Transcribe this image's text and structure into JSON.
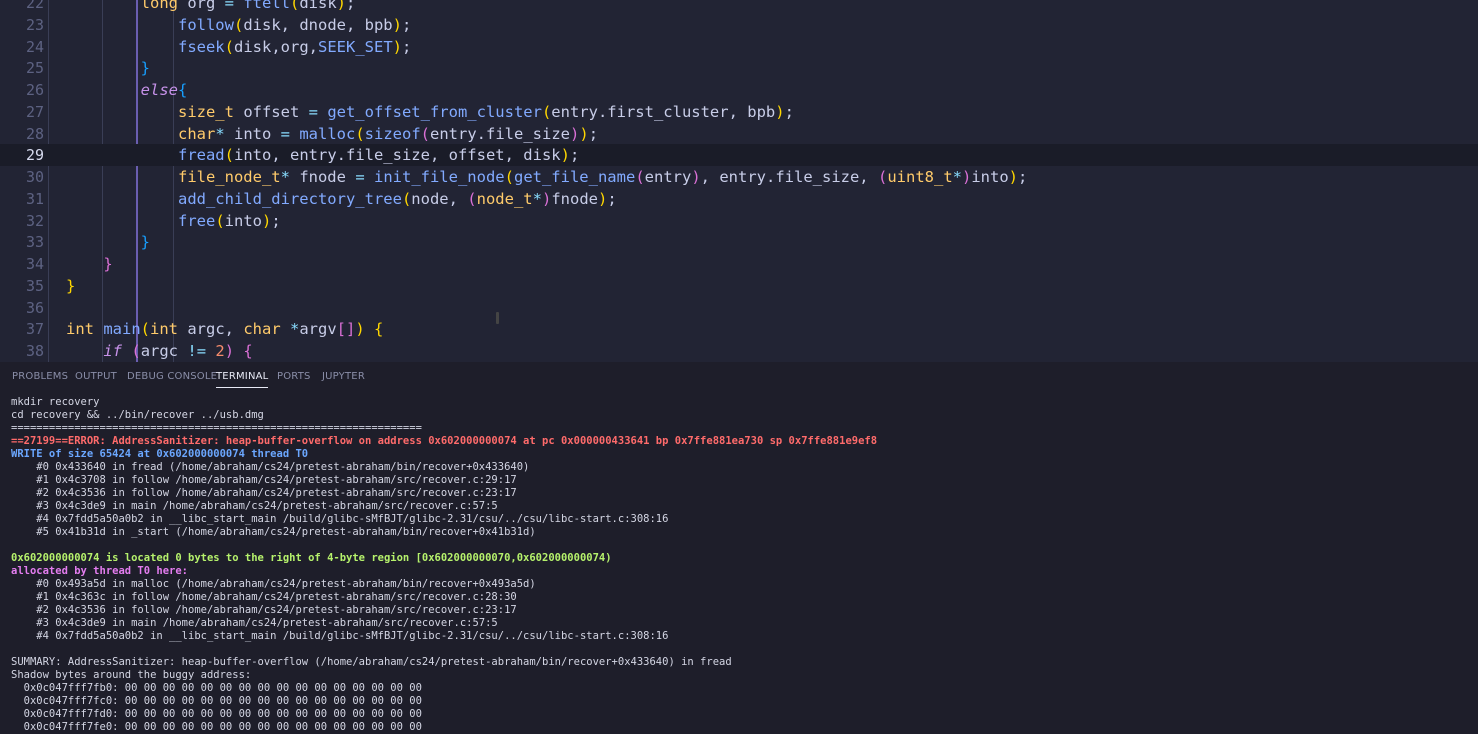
{
  "editor": {
    "lines": [
      {
        "n": "22",
        "tokens": [
          [
            "sp",
            "        "
          ],
          [
            "ty",
            "long"
          ],
          [
            "var",
            " org "
          ],
          [
            "op",
            "="
          ],
          [
            "fn",
            " ftell"
          ],
          [
            "br1",
            "("
          ],
          [
            "var",
            "disk"
          ],
          [
            "br1",
            ")"
          ],
          [
            "var",
            ";"
          ]
        ]
      },
      {
        "n": "23",
        "tokens": [
          [
            "sp",
            "            "
          ],
          [
            "fn",
            "follow"
          ],
          [
            "br1",
            "("
          ],
          [
            "var",
            "disk, dnode, bpb"
          ],
          [
            "br1",
            ")"
          ],
          [
            "var",
            ";"
          ]
        ]
      },
      {
        "n": "24",
        "tokens": [
          [
            "sp",
            "            "
          ],
          [
            "fn",
            "fseek"
          ],
          [
            "br1",
            "("
          ],
          [
            "var",
            "disk,org,"
          ],
          [
            "cst",
            "SEEK_SET"
          ],
          [
            "br1",
            ")"
          ],
          [
            "var",
            ";"
          ]
        ]
      },
      {
        "n": "25",
        "tokens": [
          [
            "sp",
            "        "
          ],
          [
            "br3",
            "}"
          ]
        ]
      },
      {
        "n": "26",
        "tokens": [
          [
            "sp",
            "        "
          ],
          [
            "kw",
            "else"
          ],
          [
            "br3",
            "{"
          ]
        ]
      },
      {
        "n": "27",
        "tokens": [
          [
            "sp",
            "            "
          ],
          [
            "ty",
            "size_t"
          ],
          [
            "var",
            " offset "
          ],
          [
            "op",
            "="
          ],
          [
            "fn",
            " get_offset_from_cluster"
          ],
          [
            "br1",
            "("
          ],
          [
            "var",
            "entry.first_cluster, bpb"
          ],
          [
            "br1",
            ")"
          ],
          [
            "var",
            ";"
          ]
        ]
      },
      {
        "n": "28",
        "tokens": [
          [
            "sp",
            "            "
          ],
          [
            "ty",
            "char"
          ],
          [
            "op",
            "*"
          ],
          [
            "var",
            " into "
          ],
          [
            "op",
            "="
          ],
          [
            "fn",
            " malloc"
          ],
          [
            "br1",
            "("
          ],
          [
            "fn",
            "sizeof"
          ],
          [
            "br2",
            "("
          ],
          [
            "var",
            "entry.file_size"
          ],
          [
            "br2",
            ")"
          ],
          [
            "br1",
            ")"
          ],
          [
            "var",
            ";"
          ]
        ]
      },
      {
        "n": "29",
        "tokens": [
          [
            "sp",
            "            "
          ],
          [
            "fn",
            "fread"
          ],
          [
            "br1",
            "("
          ],
          [
            "var",
            "into, entry.file_size, offset, disk"
          ],
          [
            "br1",
            ")"
          ],
          [
            "var",
            ";"
          ]
        ]
      },
      {
        "n": "30",
        "tokens": [
          [
            "sp",
            "            "
          ],
          [
            "ty",
            "file_node_t"
          ],
          [
            "op",
            "*"
          ],
          [
            "var",
            " fnode "
          ],
          [
            "op",
            "="
          ],
          [
            "fn",
            " init_file_node"
          ],
          [
            "br1",
            "("
          ],
          [
            "fn",
            "get_file_name"
          ],
          [
            "br2",
            "("
          ],
          [
            "var",
            "entry"
          ],
          [
            "br2",
            ")"
          ],
          [
            "var",
            ", entry.file_size, "
          ],
          [
            "br2",
            "("
          ],
          [
            "ty",
            "uint8_t"
          ],
          [
            "op",
            "*"
          ],
          [
            "br2",
            ")"
          ],
          [
            "var",
            "into"
          ],
          [
            "br1",
            ")"
          ],
          [
            "var",
            ";"
          ]
        ]
      },
      {
        "n": "31",
        "tokens": [
          [
            "sp",
            "            "
          ],
          [
            "fn",
            "add_child_directory_tree"
          ],
          [
            "br1",
            "("
          ],
          [
            "var",
            "node, "
          ],
          [
            "br2",
            "("
          ],
          [
            "ty",
            "node_t"
          ],
          [
            "op",
            "*"
          ],
          [
            "br2",
            ")"
          ],
          [
            "var",
            "fnode"
          ],
          [
            "br1",
            ")"
          ],
          [
            "var",
            ";"
          ]
        ]
      },
      {
        "n": "32",
        "tokens": [
          [
            "sp",
            "            "
          ],
          [
            "fn",
            "free"
          ],
          [
            "br1",
            "("
          ],
          [
            "var",
            "into"
          ],
          [
            "br1",
            ")"
          ],
          [
            "var",
            ";"
          ]
        ]
      },
      {
        "n": "33",
        "tokens": [
          [
            "sp",
            "        "
          ],
          [
            "br3",
            "}"
          ]
        ]
      },
      {
        "n": "34",
        "tokens": [
          [
            "sp",
            "    "
          ],
          [
            "br2",
            "}"
          ]
        ]
      },
      {
        "n": "35",
        "tokens": [
          [
            "br1",
            "}"
          ]
        ]
      },
      {
        "n": "36",
        "tokens": []
      },
      {
        "n": "37",
        "tokens": [
          [
            "ty",
            "int"
          ],
          [
            "fn",
            " main"
          ],
          [
            "br1",
            "("
          ],
          [
            "ty",
            "int"
          ],
          [
            "var",
            " argc, "
          ],
          [
            "ty",
            "char"
          ],
          [
            "op",
            " *"
          ],
          [
            "var",
            "argv"
          ],
          [
            "br2",
            "[]"
          ],
          [
            "br1",
            ")"
          ],
          [
            "var",
            " "
          ],
          [
            "br1",
            "{"
          ]
        ]
      },
      {
        "n": "38",
        "tokens": [
          [
            "sp",
            "    "
          ],
          [
            "kw",
            "if"
          ],
          [
            "var",
            " "
          ],
          [
            "br2",
            "("
          ],
          [
            "var",
            "argc "
          ],
          [
            "op",
            "!="
          ],
          [
            "var",
            " "
          ],
          [
            "num",
            "2"
          ],
          [
            "br2",
            ")"
          ],
          [
            "var",
            " "
          ],
          [
            "br2",
            "{"
          ]
        ]
      }
    ],
    "current_line": "29"
  },
  "panel": {
    "tabs": [
      {
        "label": "PROBLEMS",
        "active": false
      },
      {
        "label": "OUTPUT",
        "active": false
      },
      {
        "label": "DEBUG CONSOLE",
        "active": false
      },
      {
        "label": "TERMINAL",
        "active": true
      },
      {
        "label": "PORTS",
        "active": false
      },
      {
        "label": "JUPYTER",
        "active": false
      }
    ]
  },
  "terminal": {
    "lines": [
      {
        "style": "plain",
        "text": "mkdir recovery"
      },
      {
        "style": "plain",
        "text": "cd recovery && ../bin/recover ../usb.dmg"
      },
      {
        "style": "plain",
        "text": "================================================================="
      },
      {
        "style": "err",
        "text": "==27199==ERROR: AddressSanitizer: heap-buffer-overflow on address 0x602000000074 at pc 0x000000433641 bp 0x7ffe881ea730 sp 0x7ffe881e9ef8"
      },
      {
        "style": "blue",
        "text": "WRITE of size 65424 at 0x602000000074 thread T0"
      },
      {
        "style": "plain",
        "text": "    #0 0x433640 in fread (/home/abraham/cs24/pretest-abraham/bin/recover+0x433640)"
      },
      {
        "style": "plain",
        "text": "    #1 0x4c3708 in follow /home/abraham/cs24/pretest-abraham/src/recover.c:29:17"
      },
      {
        "style": "plain",
        "text": "    #2 0x4c3536 in follow /home/abraham/cs24/pretest-abraham/src/recover.c:23:17"
      },
      {
        "style": "plain",
        "text": "    #3 0x4c3de9 in main /home/abraham/cs24/pretest-abraham/src/recover.c:57:5"
      },
      {
        "style": "plain",
        "text": "    #4 0x7fdd5a50a0b2 in __libc_start_main /build/glibc-sMfBJT/glibc-2.31/csu/../csu/libc-start.c:308:16"
      },
      {
        "style": "plain",
        "text": "    #5 0x41b31d in _start (/home/abraham/cs24/pretest-abraham/bin/recover+0x41b31d)"
      },
      {
        "style": "plain",
        "text": ""
      },
      {
        "style": "green",
        "text": "0x602000000074 is located 0 bytes to the right of 4-byte region [0x602000000070,0x602000000074)"
      },
      {
        "style": "mag",
        "text": "allocated by thread T0 here:"
      },
      {
        "style": "plain",
        "text": "    #0 0x493a5d in malloc (/home/abraham/cs24/pretest-abraham/bin/recover+0x493a5d)"
      },
      {
        "style": "plain",
        "text": "    #1 0x4c363c in follow /home/abraham/cs24/pretest-abraham/src/recover.c:28:30"
      },
      {
        "style": "plain",
        "text": "    #2 0x4c3536 in follow /home/abraham/cs24/pretest-abraham/src/recover.c:23:17"
      },
      {
        "style": "plain",
        "text": "    #3 0x4c3de9 in main /home/abraham/cs24/pretest-abraham/src/recover.c:57:5"
      },
      {
        "style": "plain",
        "text": "    #4 0x7fdd5a50a0b2 in __libc_start_main /build/glibc-sMfBJT/glibc-2.31/csu/../csu/libc-start.c:308:16"
      },
      {
        "style": "plain",
        "text": ""
      },
      {
        "style": "plain",
        "text": "SUMMARY: AddressSanitizer: heap-buffer-overflow (/home/abraham/cs24/pretest-abraham/bin/recover+0x433640) in fread"
      },
      {
        "style": "plain",
        "text": "Shadow bytes around the buggy address:"
      },
      {
        "style": "plain",
        "text": "  0x0c047fff7fb0: 00 00 00 00 00 00 00 00 00 00 00 00 00 00 00 00"
      },
      {
        "style": "plain",
        "text": "  0x0c047fff7fc0: 00 00 00 00 00 00 00 00 00 00 00 00 00 00 00 00"
      },
      {
        "style": "plain",
        "text": "  0x0c047fff7fd0: 00 00 00 00 00 00 00 00 00 00 00 00 00 00 00 00"
      },
      {
        "style": "plain",
        "text": "  0x0c047fff7fe0: 00 00 00 00 00 00 00 00 00 00 00 00 00 00 00 00"
      }
    ]
  }
}
